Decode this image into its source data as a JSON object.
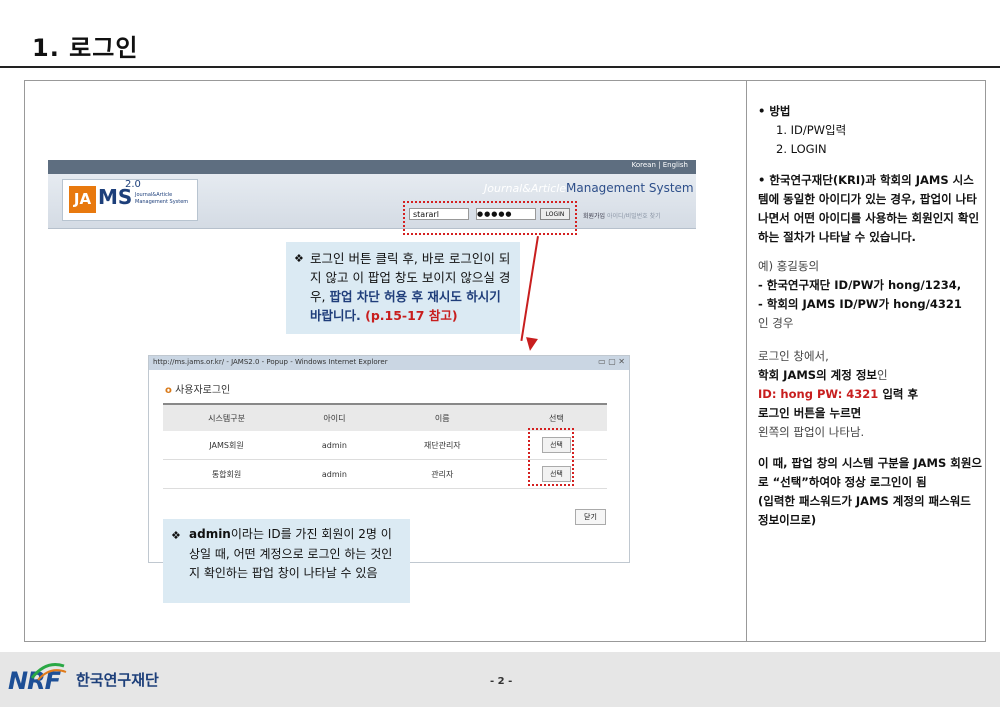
{
  "page": {
    "title": "1. 로그인",
    "page_number": "- 2 -"
  },
  "jams": {
    "lang_korean": "Korean",
    "lang_sep": "|",
    "lang_english": "English",
    "logo_ja": "JA",
    "logo_ms": "MS",
    "logo_version": "2.0",
    "logo_sub": "Journal&Article Management System",
    "system_name_1": "Journal&Article",
    "system_name_2": "Management System",
    "id_value": "stararl",
    "pw_value": "●●●●●",
    "login_button": "LOGIN",
    "link_join": "회원가입",
    "link_find": "아이디/비밀번호 찾기"
  },
  "callout1": {
    "bullet": "❖",
    "text1": "로그인 버튼 클릭 후, 바로 로그인이 되지 않고 이 팝업 창도 보이지 않으실 경우, ",
    "text_bold": "팝업 차단 허용 후 재시도 하시기 바랍니다.",
    "text_ref": " (p.15-17 참고)"
  },
  "popup": {
    "window_title": "http://ms.jams.or.kr/ - JAMS2.0 - Popup - Windows Internet Explorer",
    "window_buttons": "▭  ▢  ✕",
    "heading_icon": "o",
    "heading": "사용자로그인",
    "columns": [
      "시스템구분",
      "아이디",
      "이름",
      "선택"
    ],
    "rows": [
      {
        "system": "JAMS회원",
        "id": "admin",
        "name": "재단관리자",
        "select": "선택"
      },
      {
        "system": "통합회원",
        "id": "admin",
        "name": "관리자",
        "select": "선택"
      }
    ],
    "close_button": "닫기"
  },
  "callout2": {
    "bullet": "❖",
    "bold": "admin",
    "text": "이라는 ID를 가진 회원이 2명 이상일 때, 어떤 계정으로 로그인 하는 것인지 확인하는 팝업 창이 나타날 수 있음"
  },
  "right": {
    "method_title": "• 방법",
    "method_1": "1.  ID/PW입력",
    "method_2": "2. LOGIN",
    "note": "• 한국연구재단(KRI)과 학회의 JAMS 시스템에 동일한 아이디가 있는 경우, 팝업이 나타나면서 어떤 아이디를 사용하는 회원인지 확인하는 절차가 나타날 수 있습니다.",
    "example_intro": "예) 홍길동의",
    "example_1": "- 한국연구재단  ID/PW가 hong/1234,",
    "example_2": "- 학회의 JAMS ID/PW가 hong/4321",
    "example_3": "인 경우",
    "login_window": "로그인 창에서,",
    "account_bold": "학회 JAMS의 계정 정보",
    "account_suffix": "인",
    "cred_red": "ID: hong PW: 4321",
    "cred_suffix": " 입력 후",
    "press": "로그인 버튼을 누르면",
    "popup_appears": "왼쪽의 팝업이 나타남.",
    "final": "이 때, 팝업 창의 시스템 구분을 JAMS 회원으로 “선택”하여야 정상 로그인이 됨",
    "final_note": "(입력한 패스워드가 JAMS 계정의 패스워드 정보이므로)"
  },
  "footer": {
    "logo_text": "NRF",
    "org_name": "한국연구재단"
  },
  "colors": {
    "accent_red": "#c81e1e",
    "accent_blue": "#1f3d7a",
    "callout_bg": "#dbeaf3"
  }
}
